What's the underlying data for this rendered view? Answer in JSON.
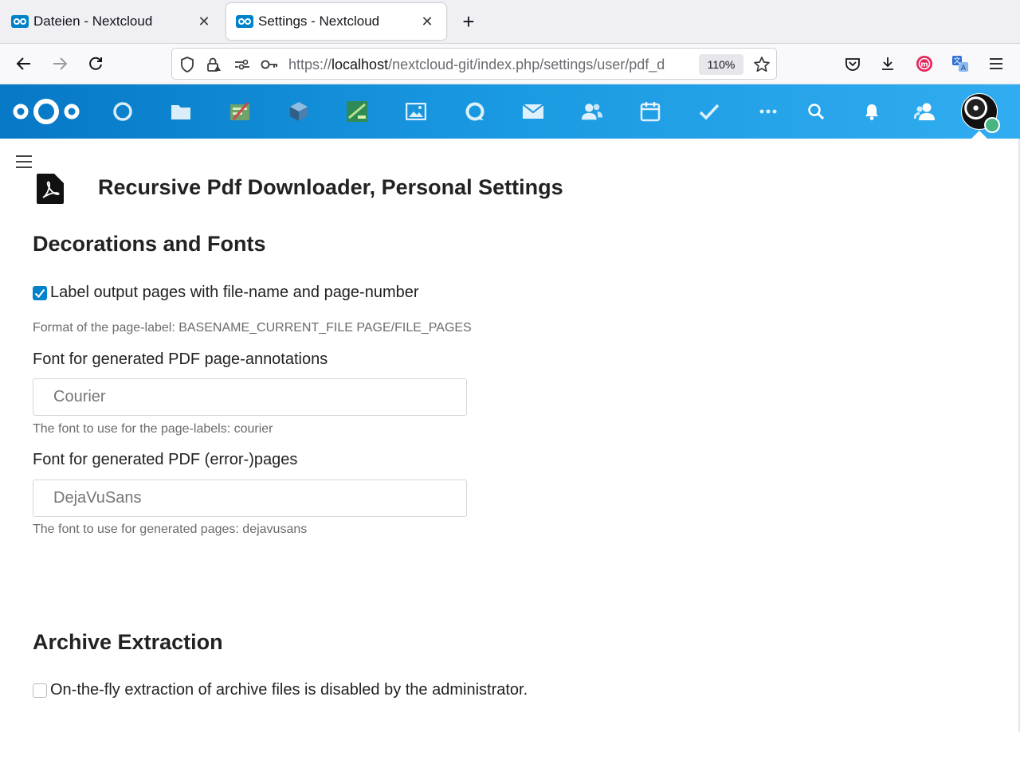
{
  "browser": {
    "tabs": [
      {
        "title": "Dateien - Nextcloud",
        "active": false
      },
      {
        "title": "Settings - Nextcloud",
        "active": true
      }
    ],
    "url": {
      "scheme": "https://",
      "host": "localhost",
      "path": "/nextcloud-git/index.php/settings/user/pdf_d"
    },
    "zoom": "110%"
  },
  "header": {
    "apps": [
      "dashboard-icon",
      "files-icon",
      "tasks-board-icon",
      "box-icon",
      "cms-icon",
      "photos-icon",
      "talk-icon",
      "mail-icon",
      "contacts-icon",
      "calendar-icon",
      "tasks-icon",
      "more-apps-icon"
    ],
    "colors": {
      "gradient_start": "#0678c6",
      "gradient_end": "#31acf0"
    },
    "status_color": "#49b382"
  },
  "page": {
    "title": "Recursive Pdf Downloader, Personal Settings",
    "decorations": {
      "heading": "Decorations and Fonts",
      "label_pages": {
        "text": "Label output pages with file-name and page-number",
        "checked": true
      },
      "format_hint": "Format of the page-label: BASENAME_CURRENT_FILE PAGE/FILE_PAGES",
      "annotation_font": {
        "label": "Font for generated PDF page-annotations",
        "placeholder": "Courier",
        "hint": "The font to use for the page-labels: courier"
      },
      "page_font": {
        "label": "Font for generated PDF (error-)pages",
        "placeholder": "DejaVuSans",
        "hint": "The font to use for generated pages: dejavusans"
      }
    },
    "archive": {
      "heading": "Archive Extraction",
      "extraction": {
        "text": "On-the-fly extraction of archive files is disabled by the administrator.",
        "checked": false
      }
    }
  }
}
